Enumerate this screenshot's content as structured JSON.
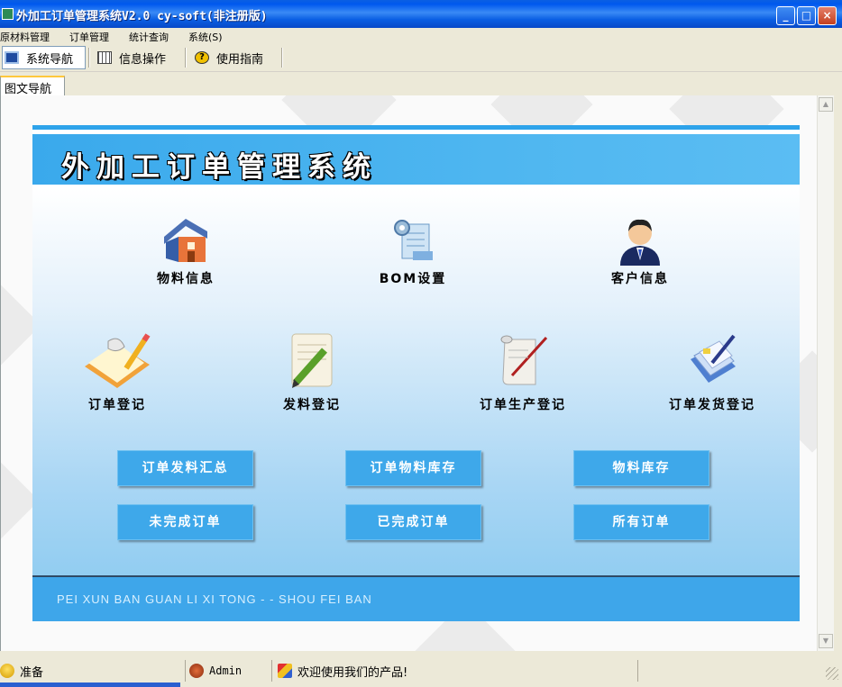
{
  "window": {
    "title": "外加工订单管理系统V2.0  cy-soft(非注册版)",
    "minimize": "_",
    "maximize": "□",
    "close": "×"
  },
  "menu": [
    "原材料管理",
    "订单管理",
    "统计查询",
    "系统(S)"
  ],
  "toolbar": {
    "nav_label": "系统导航",
    "info_label": "信息操作",
    "guide_label": "使用指南",
    "guide_icon_char": "?"
  },
  "tabs": [
    {
      "label": "图文导航",
      "active": true
    }
  ],
  "panel": {
    "title": "外加工订单管理系统",
    "footer": "PEI XUN BAN GUAN LI XI TONG - - SHOU FEI BAN"
  },
  "nav_row1": [
    {
      "label": "物料信息",
      "icon": "house-folder-icon"
    },
    {
      "label": "BOM设置",
      "icon": "settings-document-icon"
    },
    {
      "label": "客户信息",
      "icon": "customer-avatar-icon"
    }
  ],
  "nav_row2": [
    {
      "label": "订单登记",
      "icon": "notebook-pencil-icon"
    },
    {
      "label": "发料登记",
      "icon": "paper-pencil-icon"
    },
    {
      "label": "订单生产登记",
      "icon": "scroll-quill-icon"
    },
    {
      "label": "订单发货登记",
      "icon": "documents-pen-icon"
    }
  ],
  "buttons": {
    "material_summary": "订单发料汇总",
    "order_material_stock": "订单物料库存",
    "material_stock": "物料库存",
    "incomplete_orders": "未完成订单",
    "completed_orders": "已完成订单",
    "all_orders": "所有订单"
  },
  "status": {
    "ready": "准备",
    "user": "Admin",
    "message": "欢迎使用我们的产品!"
  },
  "colors": {
    "accent": "#3ea8ea",
    "title_bar": "#0a5fe3"
  }
}
